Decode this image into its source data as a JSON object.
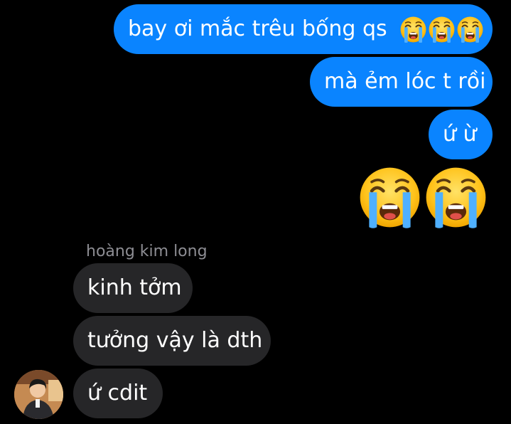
{
  "conversation": {
    "outgoing": [
      {
        "text": "bay ơi mắc trêu bống qs",
        "emoji": "loudly-crying-face",
        "emoji_count": 3
      },
      {
        "text": "mà ẻm lóc t rồi"
      },
      {
        "text": "ứ ừ"
      }
    ],
    "big_emoji": {
      "emoji": "loudly-crying-face",
      "count": 2
    },
    "incoming_sender": "hoàng kim long",
    "incoming": [
      {
        "text": "kinh tởm"
      },
      {
        "text": "tưởng vậy là dth"
      },
      {
        "text": "ứ cdit"
      }
    ]
  },
  "colors": {
    "background": "#000000",
    "outgoing_bubble": "#0a84ff",
    "incoming_bubble": "#262628",
    "sender_name": "#8d8d93",
    "text": "#ffffff"
  }
}
